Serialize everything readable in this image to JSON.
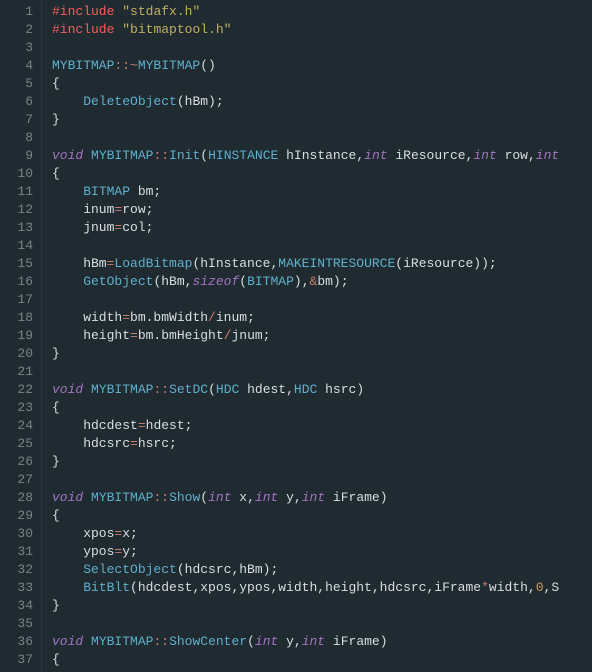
{
  "code": {
    "first_line": 1,
    "lines": [
      [
        [
          "pp",
          "#include"
        ],
        [
          "plain",
          " "
        ],
        [
          "str",
          "\"stdafx.h\""
        ]
      ],
      [
        [
          "pp",
          "#include"
        ],
        [
          "plain",
          " "
        ],
        [
          "str",
          "\"bitmaptool.h\""
        ]
      ],
      [],
      [
        [
          "type",
          "MYBITMAP"
        ],
        [
          "op",
          "::~"
        ],
        [
          "fn",
          "MYBITMAP"
        ],
        [
          "plain",
          "()"
        ]
      ],
      [
        [
          "plain",
          "{"
        ]
      ],
      [
        [
          "plain",
          "    "
        ],
        [
          "fn",
          "DeleteObject"
        ],
        [
          "plain",
          "(hBm);"
        ]
      ],
      [
        [
          "plain",
          "}"
        ]
      ],
      [],
      [
        [
          "kw",
          "void"
        ],
        [
          "plain",
          " "
        ],
        [
          "type",
          "MYBITMAP"
        ],
        [
          "op",
          "::"
        ],
        [
          "fn",
          "Init"
        ],
        [
          "plain",
          "("
        ],
        [
          "type",
          "HINSTANCE"
        ],
        [
          "plain",
          " hInstance,"
        ],
        [
          "kw",
          "int"
        ],
        [
          "plain",
          " iResource,"
        ],
        [
          "kw",
          "int"
        ],
        [
          "plain",
          " row,"
        ],
        [
          "kw",
          "int"
        ]
      ],
      [
        [
          "plain",
          "{"
        ]
      ],
      [
        [
          "plain",
          "    "
        ],
        [
          "type",
          "BITMAP"
        ],
        [
          "plain",
          " bm;"
        ]
      ],
      [
        [
          "plain",
          "    inum"
        ],
        [
          "op",
          "="
        ],
        [
          "plain",
          "row;"
        ]
      ],
      [
        [
          "plain",
          "    jnum"
        ],
        [
          "op",
          "="
        ],
        [
          "plain",
          "col;"
        ]
      ],
      [],
      [
        [
          "plain",
          "    hBm"
        ],
        [
          "op",
          "="
        ],
        [
          "fn",
          "LoadBitmap"
        ],
        [
          "plain",
          "(hInstance,"
        ],
        [
          "fn",
          "MAKEINTRESOURCE"
        ],
        [
          "plain",
          "(iResource));"
        ]
      ],
      [
        [
          "plain",
          "    "
        ],
        [
          "fn",
          "GetObject"
        ],
        [
          "plain",
          "(hBm,"
        ],
        [
          "kw",
          "sizeof"
        ],
        [
          "plain",
          "("
        ],
        [
          "type",
          "BITMAP"
        ],
        [
          "plain",
          "),"
        ],
        [
          "op",
          "&"
        ],
        [
          "plain",
          "bm);"
        ]
      ],
      [],
      [
        [
          "plain",
          "    width"
        ],
        [
          "op",
          "="
        ],
        [
          "plain",
          "bm.bmWidth"
        ],
        [
          "op",
          "/"
        ],
        [
          "plain",
          "inum;"
        ]
      ],
      [
        [
          "plain",
          "    height"
        ],
        [
          "op",
          "="
        ],
        [
          "plain",
          "bm.bmHeight"
        ],
        [
          "op",
          "/"
        ],
        [
          "plain",
          "jnum;"
        ]
      ],
      [
        [
          "plain",
          "}"
        ]
      ],
      [],
      [
        [
          "kw",
          "void"
        ],
        [
          "plain",
          " "
        ],
        [
          "type",
          "MYBITMAP"
        ],
        [
          "op",
          "::"
        ],
        [
          "fn",
          "SetDC"
        ],
        [
          "plain",
          "("
        ],
        [
          "type",
          "HDC"
        ],
        [
          "plain",
          " hdest,"
        ],
        [
          "type",
          "HDC"
        ],
        [
          "plain",
          " hsrc)"
        ]
      ],
      [
        [
          "plain",
          "{"
        ]
      ],
      [
        [
          "plain",
          "    hdcdest"
        ],
        [
          "op",
          "="
        ],
        [
          "plain",
          "hdest;"
        ]
      ],
      [
        [
          "plain",
          "    hdcsrc"
        ],
        [
          "op",
          "="
        ],
        [
          "plain",
          "hsrc;"
        ]
      ],
      [
        [
          "plain",
          "}"
        ]
      ],
      [],
      [
        [
          "kw",
          "void"
        ],
        [
          "plain",
          " "
        ],
        [
          "type",
          "MYBITMAP"
        ],
        [
          "op",
          "::"
        ],
        [
          "fn",
          "Show"
        ],
        [
          "plain",
          "("
        ],
        [
          "kw",
          "int"
        ],
        [
          "plain",
          " x,"
        ],
        [
          "kw",
          "int"
        ],
        [
          "plain",
          " y,"
        ],
        [
          "kw",
          "int"
        ],
        [
          "plain",
          " iFrame)"
        ]
      ],
      [
        [
          "plain",
          "{"
        ]
      ],
      [
        [
          "plain",
          "    xpos"
        ],
        [
          "op",
          "="
        ],
        [
          "plain",
          "x;"
        ]
      ],
      [
        [
          "plain",
          "    ypos"
        ],
        [
          "op",
          "="
        ],
        [
          "plain",
          "y;"
        ]
      ],
      [
        [
          "plain",
          "    "
        ],
        [
          "fn",
          "SelectObject"
        ],
        [
          "plain",
          "(hdcsrc,hBm);"
        ]
      ],
      [
        [
          "plain",
          "    "
        ],
        [
          "fn",
          "BitBlt"
        ],
        [
          "plain",
          "(hdcdest,xpos,ypos,width,height,hdcsrc,iFrame"
        ],
        [
          "op",
          "*"
        ],
        [
          "plain",
          "width,"
        ],
        [
          "num",
          "0"
        ],
        [
          "plain",
          ",S"
        ]
      ],
      [
        [
          "plain",
          "}"
        ]
      ],
      [],
      [
        [
          "kw",
          "void"
        ],
        [
          "plain",
          " "
        ],
        [
          "type",
          "MYBITMAP"
        ],
        [
          "op",
          "::"
        ],
        [
          "fn",
          "ShowCenter"
        ],
        [
          "plain",
          "("
        ],
        [
          "kw",
          "int"
        ],
        [
          "plain",
          " y,"
        ],
        [
          "kw",
          "int"
        ],
        [
          "plain",
          " iFrame)"
        ]
      ],
      [
        [
          "plain",
          "{"
        ]
      ]
    ]
  }
}
